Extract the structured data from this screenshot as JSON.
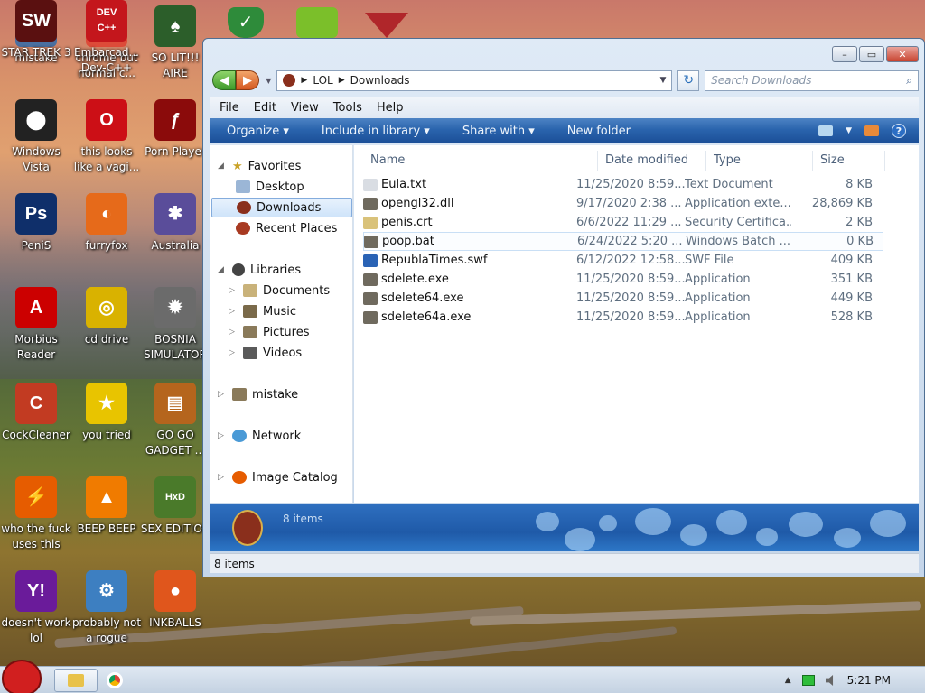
{
  "desktop": {
    "icons": [
      {
        "label": "mistake",
        "glyph": "▣",
        "color": "#4a6fa0"
      },
      {
        "label": "chrome but normal c...",
        "glyph": "◉",
        "color": "#dd4b39"
      },
      {
        "label": "SO LIT!!! AIRE",
        "glyph": "♠",
        "color": "#2c5e2a"
      },
      {
        "label": "Windows Vista",
        "glyph": "⬤",
        "color": "#222"
      },
      {
        "label": "this looks like a vagi...",
        "glyph": "O",
        "color": "#cc0f16"
      },
      {
        "label": "Porn Player",
        "glyph": "ƒ",
        "color": "#8b0b0b"
      },
      {
        "label": "PeniS",
        "glyph": "Ps",
        "color": "#0f2f6a"
      },
      {
        "label": "furryfox",
        "glyph": "◐",
        "color": "#e66a1a"
      },
      {
        "label": "Australia",
        "glyph": "✱",
        "color": "#5a4d9a"
      },
      {
        "label": "Morbius Reader",
        "glyph": "A",
        "color": "#c00"
      },
      {
        "label": "cd drive",
        "glyph": "◎",
        "color": "#d9b200"
      },
      {
        "label": "BOSNIA SIMULATOR",
        "glyph": "✹",
        "color": "#6b6b6b"
      },
      {
        "label": "CockCleaner",
        "glyph": "C",
        "color": "#c23b22"
      },
      {
        "label": "you tried",
        "glyph": "★",
        "color": "#e8c400"
      },
      {
        "label": "GO GO GADGET ...",
        "glyph": "▤",
        "color": "#b5651d"
      },
      {
        "label": "who the fuck uses this",
        "glyph": "⚡",
        "color": "#e65c00"
      },
      {
        "label": "BEEP BEEP",
        "glyph": "▲",
        "color": "#f07b00"
      },
      {
        "label": "SEX EDITIOR",
        "glyph": "HxD",
        "color": "#4a7a2a"
      },
      {
        "label": "doesn't work lol",
        "glyph": "Y!",
        "color": "#6a1b9a"
      },
      {
        "label": "probably not a rogue",
        "glyph": "⚙",
        "color": "#3d7fc1"
      },
      {
        "label": "INKBALLS",
        "glyph": "●",
        "color": "#e0561c"
      },
      {
        "label": "STAR TREK 3",
        "glyph": "SW",
        "color": "#5a1010"
      },
      {
        "label": "Embarcad... Dev-C++",
        "glyph": "DEV C++",
        "color": "#c4161c"
      }
    ],
    "top_partial_icons": [
      {
        "name": "shield-icon",
        "color": "#2e8b3a"
      },
      {
        "name": "angry-birds-pig-icon",
        "color": "#7bbf2a"
      },
      {
        "name": "red-emblem-icon",
        "color": "#b0262a"
      }
    ]
  },
  "window": {
    "title": "Downloads",
    "controls": {
      "minimize": "–",
      "maximize": "▭",
      "close": "✕"
    },
    "breadcrumb": [
      "LOL",
      "Downloads"
    ],
    "search_placeholder": "Search Downloads",
    "menu": [
      "File",
      "Edit",
      "View",
      "Tools",
      "Help"
    ],
    "commands": [
      "Organize ▾",
      "Include in library ▾",
      "Share with ▾",
      "New folder"
    ],
    "help_glyph": "?",
    "nav": {
      "favorites": "Favorites",
      "favorites_items": [
        "Desktop",
        "Downloads",
        "Recent Places"
      ],
      "libraries": "Libraries",
      "libraries_items": [
        "Documents",
        "Music",
        "Pictures",
        "Videos"
      ],
      "mistake": "mistake",
      "network": "Network",
      "image_catalog": "Image Catalog"
    },
    "columns": [
      "Name",
      "Date modified",
      "Type",
      "Size"
    ],
    "files": [
      {
        "name": "Eula.txt",
        "date": "11/25/2020 8:59...",
        "type": "Text Document",
        "size": "8 KB",
        "icon_color": "#d9dde3"
      },
      {
        "name": "opengl32.dll",
        "date": "9/17/2020 2:38 ...",
        "type": "Application exte...",
        "size": "28,869 KB",
        "icon_color": "#6f6a5e"
      },
      {
        "name": "penis.crt",
        "date": "6/6/2022 11:29 ...",
        "type": "Security Certifica...",
        "size": "2 KB",
        "icon_color": "#d9c27a"
      },
      {
        "name": "poop.bat",
        "date": "6/24/2022 5:20 ...",
        "type": "Windows Batch ...",
        "size": "0 KB",
        "icon_color": "#6f6a5e"
      },
      {
        "name": "RepublaTimes.swf",
        "date": "6/12/2022 12:58...",
        "type": "SWF File",
        "size": "409 KB",
        "icon_color": "#2a63b5"
      },
      {
        "name": "sdelete.exe",
        "date": "11/25/2020 8:59...",
        "type": "Application",
        "size": "351 KB",
        "icon_color": "#6f6a5e"
      },
      {
        "name": "sdelete64.exe",
        "date": "11/25/2020 8:59...",
        "type": "Application",
        "size": "449 KB",
        "icon_color": "#6f6a5e"
      },
      {
        "name": "sdelete64a.exe",
        "date": "11/25/2020 8:59...",
        "type": "Application",
        "size": "528 KB",
        "icon_color": "#6f6a5e"
      }
    ],
    "details_count": "8 items",
    "status": "8 items"
  },
  "taskbar": {
    "clock": "5:21 PM",
    "tray_arrow": "▲"
  }
}
